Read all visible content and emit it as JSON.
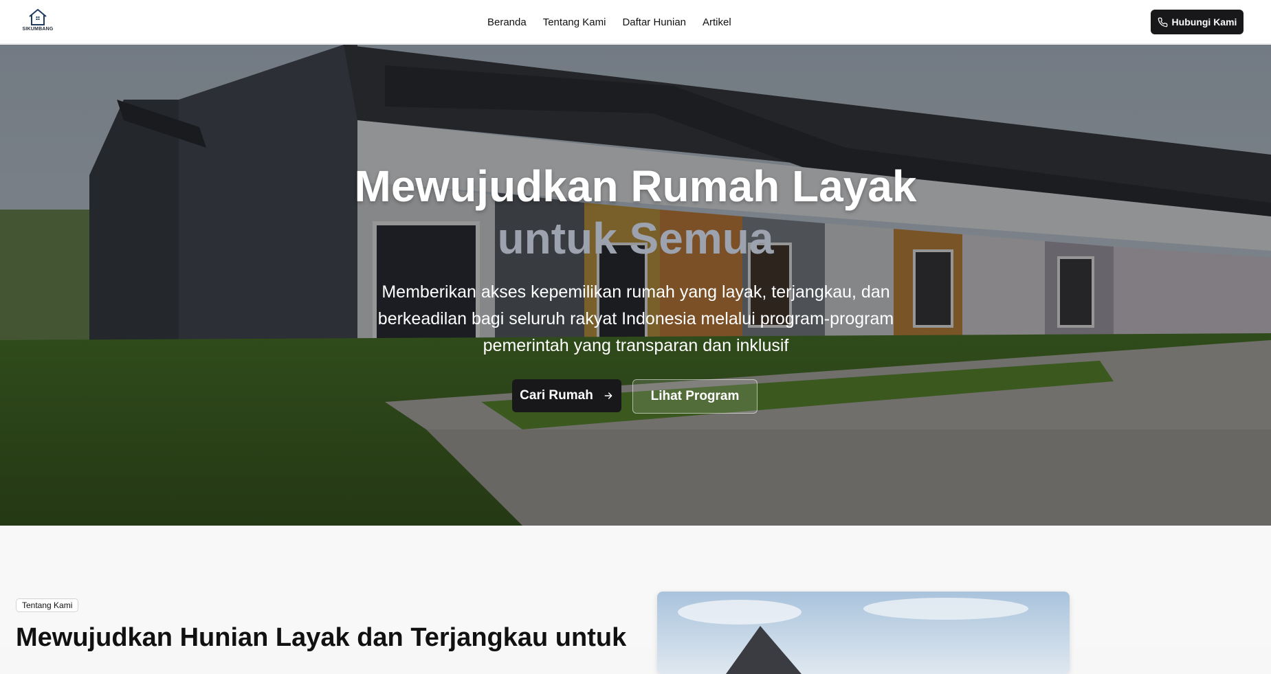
{
  "brand": {
    "name": "SIKUMBANG",
    "logo_icon": "house-icon"
  },
  "nav": {
    "items": [
      {
        "label": "Beranda"
      },
      {
        "label": "Tentang Kami"
      },
      {
        "label": "Daftar Hunian"
      },
      {
        "label": "Artikel"
      }
    ],
    "contact_label": "Hubungi Kami",
    "contact_icon": "phone-icon"
  },
  "hero": {
    "title_line1": "Mewujudkan Rumah Layak",
    "title_line2": "untuk Semua",
    "subtitle": "Memberikan akses kepemilikan rumah yang layak, terjangkau, dan berkeadilan bagi seluruh rakyat Indonesia melalui program-program pemerintah yang transparan dan inklusif",
    "primary_button": "Cari Rumah",
    "primary_icon": "arrow-right-icon",
    "secondary_button": "Lihat Program"
  },
  "about": {
    "badge": "Tentang Kami",
    "title": "Mewujudkan Hunian Layak dan Terjangkau untuk"
  },
  "colors": {
    "dark": "#18181b",
    "accent_gray": "#9ca3af",
    "background": "#f8f8f8"
  }
}
